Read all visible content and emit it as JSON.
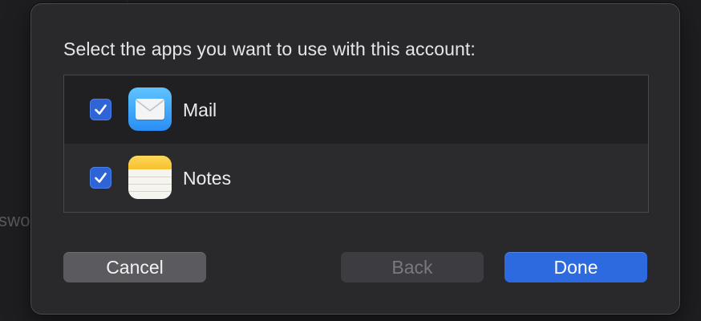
{
  "background": {
    "partial_text": "swo"
  },
  "dialog": {
    "prompt": "Select the apps you want to use with this account:",
    "apps": [
      {
        "name": "Mail",
        "checked": true,
        "icon": "mail-icon"
      },
      {
        "name": "Notes",
        "checked": true,
        "icon": "notes-icon"
      }
    ],
    "buttons": {
      "cancel": "Cancel",
      "back": "Back",
      "done": "Done"
    }
  },
  "colors": {
    "accent": "#2d6ae0",
    "checkbox": "#2f64d6",
    "sheet_bg": "#29292c"
  }
}
